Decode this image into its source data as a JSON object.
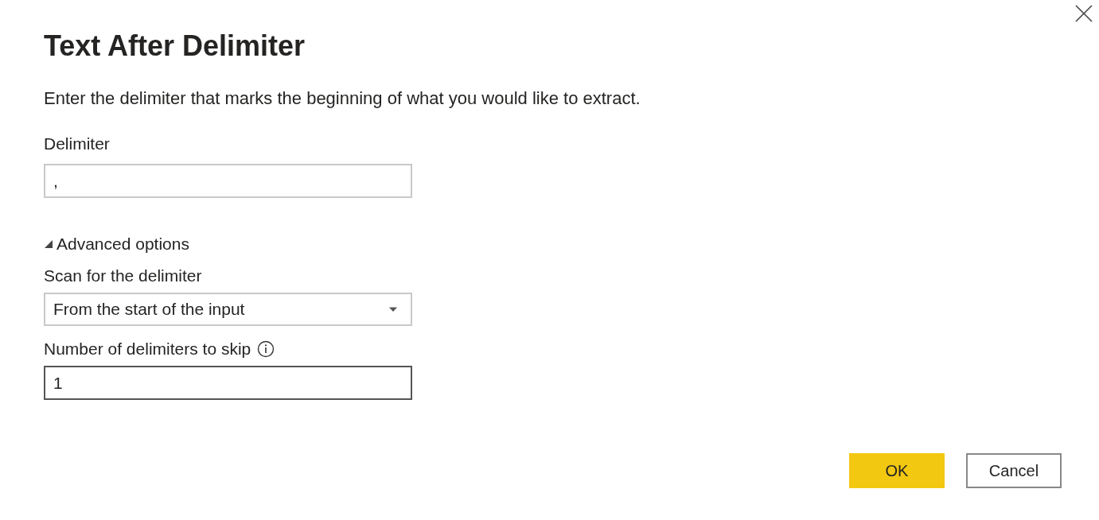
{
  "dialog": {
    "title": "Text After Delimiter",
    "description": "Enter the delimiter that marks the beginning of what you would like to extract."
  },
  "delimiter": {
    "label": "Delimiter",
    "value": ","
  },
  "advanced": {
    "label": "Advanced options",
    "expanded": true
  },
  "scan": {
    "label": "Scan for the delimiter",
    "value": "From the start of the input"
  },
  "skip": {
    "label": "Number of delimiters to skip",
    "value": "1",
    "focused": true
  },
  "buttons": [
    {
      "label": "OK",
      "kind": "primary"
    },
    {
      "label": "Cancel",
      "kind": "secondary"
    }
  ]
}
